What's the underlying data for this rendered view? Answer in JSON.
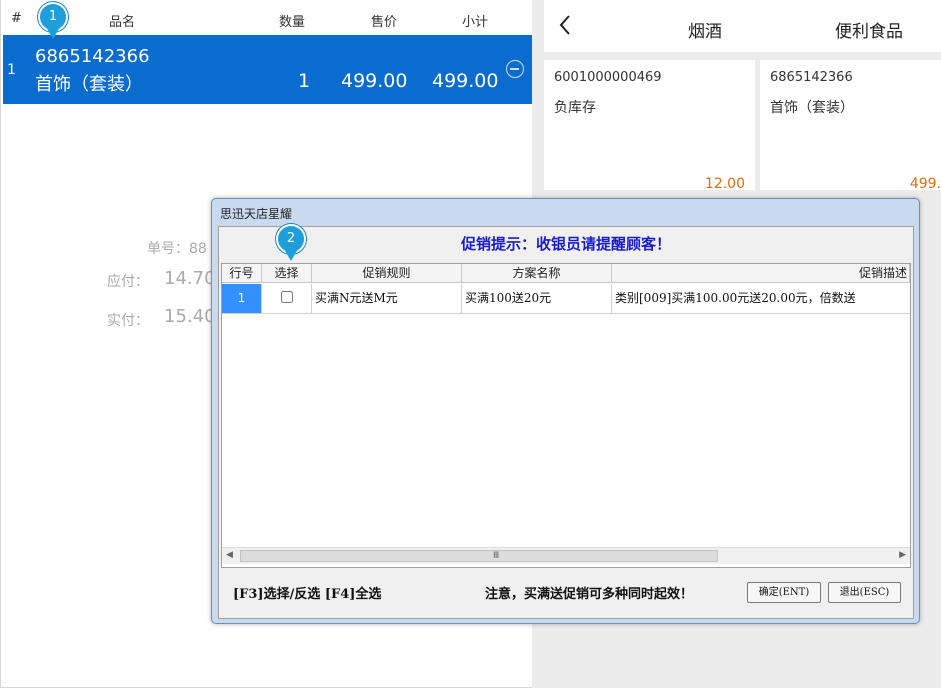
{
  "cart": {
    "headers": {
      "idx": "#",
      "name": "品名",
      "qty": "数量",
      "price": "售价",
      "subtotal": "小计"
    },
    "row": {
      "idx": "1",
      "code": "6865142366",
      "name": "首饰（套装）",
      "qty": "1",
      "price": "499.00",
      "subtotal": "499.00"
    },
    "callout1": "1"
  },
  "summary": {
    "order_label": "单号：88",
    "due_label": "应付：",
    "due_value": "14.70",
    "paid_label": "实付：",
    "paid_value": "15.40"
  },
  "right": {
    "back_icon": "chevron-left-icon",
    "tabs": [
      "烟酒",
      "便利食品"
    ],
    "products": [
      {
        "code": "6001000000469",
        "name": "负库存",
        "price": "12.00"
      },
      {
        "code": "6865142366",
        "name": "首饰（套装）",
        "price": "499."
      }
    ]
  },
  "dialog": {
    "title": "思迅天店星耀",
    "promo_text": "促销提示：收银员请提醒顾客！",
    "callout2": "2",
    "columns": [
      "行号",
      "选择",
      "促销规则",
      "方案名称",
      "促销描述"
    ],
    "rows": [
      {
        "no": "1",
        "checked": false,
        "rule": "买满N元送M元",
        "plan": "买满100送20元",
        "desc": "类别[009]买满100.00元送20.00元，倍数送"
      }
    ],
    "scroll_grip": "Ⅲ",
    "hint_left": "[F3]选择/反选  [F4]全选",
    "hint_right": "注意，买满送促销可多种同时起效！",
    "ok_label": "确定(ENT)",
    "exit_label": "退出(ESC)"
  }
}
